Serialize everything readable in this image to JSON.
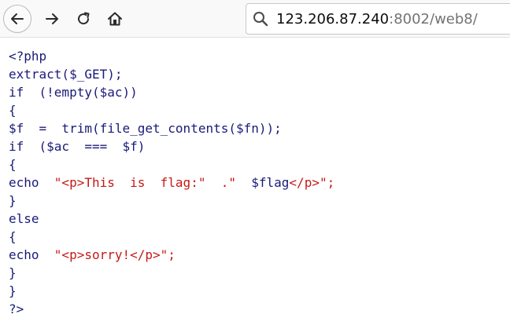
{
  "browser": {
    "url_host": "123.206.87.240",
    "url_rest": ":8002/web8/",
    "icons": {
      "back": "arrow-left-icon",
      "forward": "arrow-right-icon",
      "reload": "reload-icon",
      "home": "home-icon",
      "search": "search-icon"
    }
  },
  "code_lines": [
    [
      {
        "t": "<?php",
        "c": "plain"
      }
    ],
    [
      {
        "t": "extract($_GET);",
        "c": "plain"
      }
    ],
    [
      {
        "t": "if  (!empty($ac))",
        "c": "plain"
      }
    ],
    [
      {
        "t": "{",
        "c": "plain"
      }
    ],
    [
      {
        "t": "$f  =  trim(file_get_contents($fn));",
        "c": "plain"
      }
    ],
    [
      {
        "t": "if  ($ac  ===  $f)",
        "c": "plain"
      }
    ],
    [
      {
        "t": "{",
        "c": "plain"
      }
    ],
    [
      {
        "t": "echo  ",
        "c": "plain"
      },
      {
        "t": "\"<p>This  is  flag:\"  .\"  ",
        "c": "str"
      },
      {
        "t": "$flag",
        "c": "plain"
      },
      {
        "t": "</p>\";",
        "c": "str"
      }
    ],
    [
      {
        "t": "}",
        "c": "plain"
      }
    ],
    [
      {
        "t": "else",
        "c": "plain"
      }
    ],
    [
      {
        "t": "{",
        "c": "plain"
      }
    ],
    [
      {
        "t": "echo  ",
        "c": "plain"
      },
      {
        "t": "\"<p>sorry!</p>\";",
        "c": "str"
      }
    ],
    [
      {
        "t": "}",
        "c": "plain"
      }
    ],
    [
      {
        "t": "}",
        "c": "plain"
      }
    ],
    [
      {
        "t": "?>",
        "c": "plain"
      }
    ]
  ],
  "colors": {
    "code_text": "#1a1a7a",
    "string_text": "#c41a16"
  }
}
